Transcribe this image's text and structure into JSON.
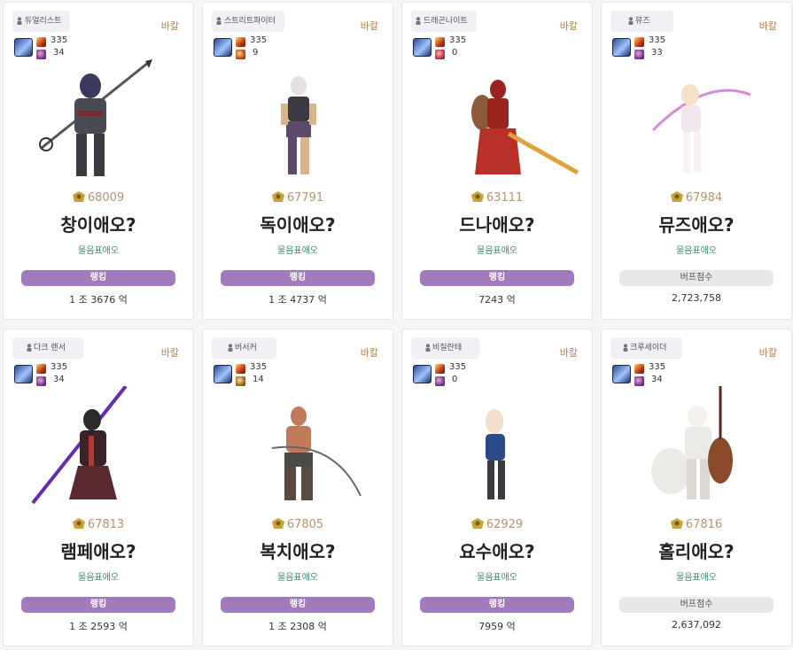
{
  "cards": [
    {
      "job": "듀얼리스트",
      "server": "바칼",
      "level": "335",
      "sub": "34",
      "fame": "68009",
      "name": "창이애오?",
      "guild": "물음표애오",
      "tag": "랭킹",
      "tag_type": "rank",
      "value": "1 조 3676 억",
      "colors": {
        "main": "#4a4a55",
        "accent": "#7a2c2c"
      }
    },
    {
      "job": "스트리트파이터",
      "server": "바칼",
      "level": "335",
      "sub": "9",
      "fame": "67791",
      "name": "독이애오?",
      "guild": "물음표애오",
      "tag": "랭킹",
      "tag_type": "rank",
      "value": "1 조 4737 억",
      "colors": {
        "main": "#5b4a6a",
        "accent": "#d8b48a"
      }
    },
    {
      "job": "드래곤나이트",
      "server": "바칼",
      "level": "335",
      "sub": "0",
      "fame": "63111",
      "name": "드나애오?",
      "guild": "물음표애오",
      "tag": "랭킹",
      "tag_type": "rank",
      "value": "7243 억",
      "colors": {
        "main": "#9a2320",
        "accent": "#e0a23a"
      }
    },
    {
      "job": "뮤즈",
      "server": "바칼",
      "level": "335",
      "sub": "33",
      "fame": "67984",
      "name": "뮤즈애오?",
      "guild": "물음표애오",
      "tag": "버프점수",
      "tag_type": "buff",
      "value": "2,723,758",
      "colors": {
        "main": "#f2e6ee",
        "accent": "#d88ad8"
      }
    },
    {
      "job": "다크 랜서",
      "server": "바칼",
      "level": "335",
      "sub": "34",
      "fame": "67813",
      "name": "램페애오?",
      "guild": "물음표애오",
      "tag": "랭킹",
      "tag_type": "rank",
      "value": "1 조 2593 억",
      "colors": {
        "main": "#3a2226",
        "accent": "#6a2ab0"
      }
    },
    {
      "job": "버서커",
      "server": "바칼",
      "level": "335",
      "sub": "14",
      "fame": "67805",
      "name": "복치애오?",
      "guild": "물음표애오",
      "tag": "랭킹",
      "tag_type": "rank",
      "value": "1 조 2308 억",
      "colors": {
        "main": "#5a4a44",
        "accent": "#c07a5a"
      }
    },
    {
      "job": "비질란테",
      "server": "바칼",
      "level": "335",
      "sub": "0",
      "fame": "62929",
      "name": "요수애오?",
      "guild": "물음표애오",
      "tag": "랭킹",
      "tag_type": "rank",
      "value": "7959 억",
      "colors": {
        "main": "#2a4a8a",
        "accent": "#f2e0cc"
      }
    },
    {
      "job": "크루세이더",
      "server": "바칼",
      "level": "335",
      "sub": "34",
      "fame": "67816",
      "name": "홀리애오?",
      "guild": "물음표애오",
      "tag": "버프점수",
      "tag_type": "buff",
      "value": "2,637,092",
      "colors": {
        "main": "#eceae6",
        "accent": "#8a4a2a"
      }
    }
  ]
}
